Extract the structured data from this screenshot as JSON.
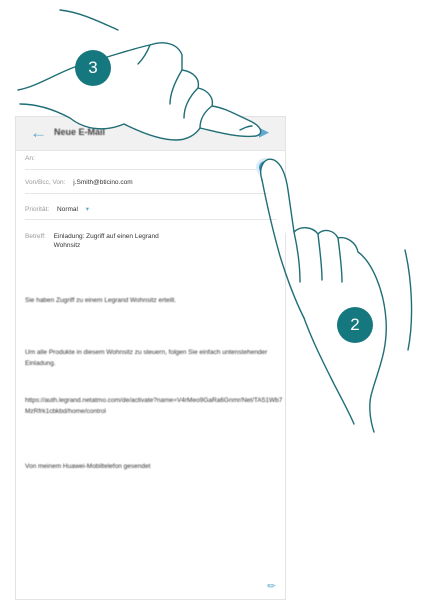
{
  "appbar": {
    "title": "Neue E-Mail",
    "subtitle": "",
    "back_icon": "back-arrow-icon",
    "send_icon": "send-icon",
    "accent": "#5fa9cf"
  },
  "form": {
    "to_label": "An:",
    "from_label": "Von/Bcc, Von:",
    "from_value": "j.Smith@bticino.com",
    "priority_label": "Priorität:",
    "priority_value": "Normal",
    "subject_label": "Betreff:",
    "subject_value": "Einladung: Zugriff auf einen Legrand Wohnsitz",
    "add_contact_symbol": "+"
  },
  "body": {
    "p1": "Sie haben Zugriff zu einem Legrand Wohnsitz erteilt.",
    "p2": "Um alle Produkte in diesem Wohnsitz zu steuern, folgen Sie einfach untenstehender Einladung.",
    "p3": "https://auth.legrand.netatmo.com/de/activate?name=V4rMeo9GaRa6Gnmr/Net/TA51Wb7MzRfrk1cbkbd/home/control",
    "p4": "Von meinem Huawei-Mobiltelefon gesendet"
  },
  "callouts": {
    "step_a": "3",
    "step_b": "2",
    "color": "#16787f"
  }
}
